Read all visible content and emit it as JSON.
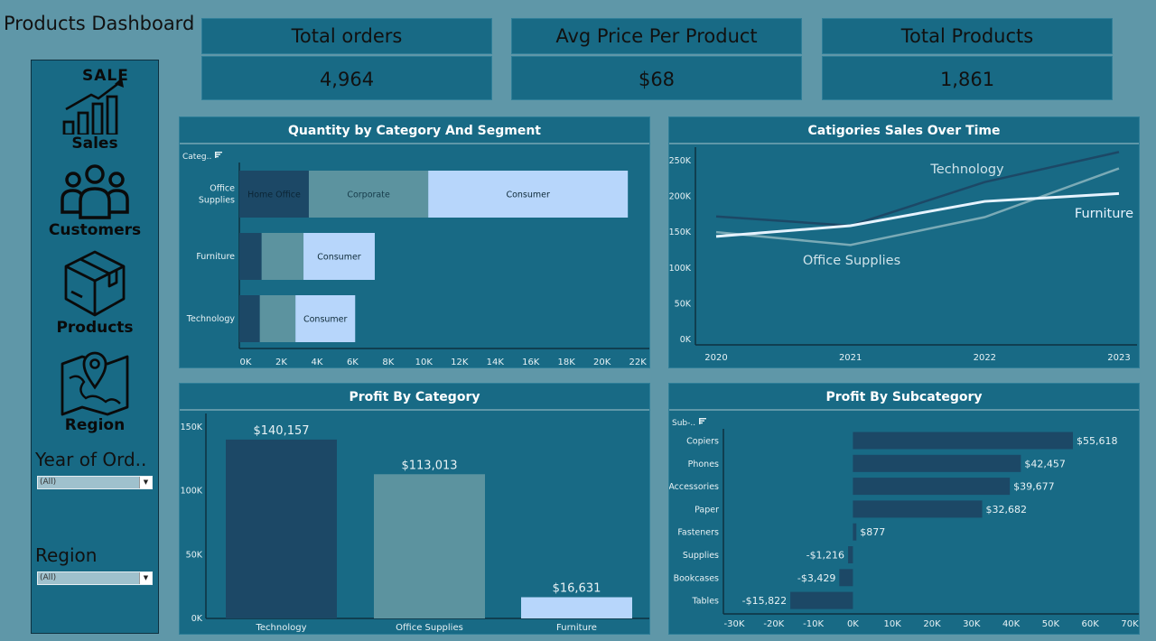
{
  "dashboard": {
    "title": "Products Dashboard"
  },
  "sidebar": {
    "items": [
      {
        "label": "Sales",
        "icon": "sales-chart-icon",
        "icon_text": "SALE"
      },
      {
        "label": "Customers",
        "icon": "customers-icon"
      },
      {
        "label": "Products",
        "icon": "box-icon"
      },
      {
        "label": "Region",
        "icon": "map-pin-icon"
      }
    ],
    "filters": [
      {
        "label": "Year of Ord..",
        "value": "(All)"
      },
      {
        "label": "Region",
        "value": "(All)"
      }
    ]
  },
  "kpis": [
    {
      "label": "Total orders",
      "value": "4,964"
    },
    {
      "label": "Avg Price  Per Product",
      "value": "$68"
    },
    {
      "label": "Total Products",
      "value": "1,861"
    }
  ],
  "colors": {
    "background": "#5f97a8",
    "panel": "#186a85",
    "dark": "#1c4866",
    "mid": "#5c939f",
    "light": "#b7d6fb"
  },
  "chart_data": [
    {
      "type": "bar",
      "orientation": "horizontal-stacked",
      "title": "Quantity by Category And Segment",
      "row_header": "Categ..",
      "categories": [
        "Office Supplies",
        "Furniture",
        "Technology"
      ],
      "category_labels": [
        [
          "Office",
          "Supplies"
        ],
        [
          "Furniture"
        ],
        [
          "Technology"
        ]
      ],
      "series": [
        {
          "name": "Home Office",
          "values": [
            3900,
            1250,
            1150
          ],
          "labels": [
            "Home Office",
            "",
            ""
          ],
          "color": "#1c4866",
          "text_color": "#0b2535"
        },
        {
          "name": "Corporate",
          "values": [
            6700,
            2350,
            2000
          ],
          "labels": [
            "Corporate",
            "",
            ""
          ],
          "color": "#5c939f",
          "text_color": "#163b4a"
        },
        {
          "name": "Consumer",
          "values": [
            11200,
            4000,
            3350
          ],
          "labels": [
            "Consumer",
            "Consumer",
            "Consumer"
          ],
          "color": "#b7d6fb",
          "text_color": "#0e2a38"
        }
      ],
      "xlim": [
        0,
        22500
      ],
      "xticks": [
        0,
        2000,
        4000,
        6000,
        8000,
        10000,
        12000,
        14000,
        16000,
        18000,
        20000,
        22000
      ],
      "xtick_labels": [
        "0K",
        "2K",
        "4K",
        "6K",
        "8K",
        "10K",
        "12K",
        "14K",
        "16K",
        "18K",
        "20K",
        "22K"
      ]
    },
    {
      "type": "line",
      "title": "Catigories Sales Over Time",
      "x": [
        "2020",
        "2021",
        "2022",
        "2023"
      ],
      "series": [
        {
          "name": "Technology",
          "values": [
            172000,
            159000,
            220000,
            262000
          ],
          "color": "#1c4866",
          "label_color": "#cfe3ea"
        },
        {
          "name": "Furniture",
          "values": [
            144000,
            159000,
            193000,
            204000
          ],
          "color": "#e6f3ff",
          "label_color": "#e6f3ff"
        },
        {
          "name": "Office Supplies",
          "values": [
            150000,
            132000,
            171000,
            239000
          ],
          "color": "#7aaab6",
          "label_color": "#cfe3ea"
        }
      ],
      "ylim": [
        0,
        265000
      ],
      "yticks": [
        0,
        50000,
        100000,
        150000,
        200000,
        250000
      ],
      "ytick_labels": [
        "0K",
        "50K",
        "100K",
        "150K",
        "200K",
        "250K"
      ]
    },
    {
      "type": "bar",
      "title": "Profit By Category",
      "categories": [
        "Technology",
        "Office Supplies",
        "Furniture"
      ],
      "values": [
        140157,
        113013,
        16631
      ],
      "value_labels": [
        "$140,157",
        "$113,013",
        "$16,631"
      ],
      "colors": [
        "#1c4866",
        "#5c939f",
        "#b7d6fb"
      ],
      "ylim": [
        0,
        150000
      ],
      "yticks": [
        0,
        50000,
        100000,
        150000
      ],
      "ytick_labels": [
        "0K",
        "50K",
        "100K",
        "150K"
      ]
    },
    {
      "type": "bar",
      "orientation": "horizontal",
      "title": "Profit By Subcategory",
      "row_header": "Sub-..",
      "categories": [
        "Copiers",
        "Phones",
        "Accessories",
        "Paper",
        "Fasteners",
        "Supplies",
        "Bookcases",
        "Tables"
      ],
      "values": [
        55618,
        42457,
        39677,
        32682,
        877,
        -1216,
        -3429,
        -15822
      ],
      "value_labels": [
        "$55,618",
        "$42,457",
        "$39,677",
        "$32,682",
        "$877",
        "-$1,216",
        "-$3,429",
        "-$15,822"
      ],
      "color": "#1c4866",
      "xlim": [
        -30000,
        70000
      ],
      "xticks": [
        -30000,
        -20000,
        -10000,
        0,
        10000,
        20000,
        30000,
        40000,
        50000,
        60000,
        70000
      ],
      "xtick_labels": [
        "-30K",
        "-20K",
        "-10K",
        "0K",
        "10K",
        "20K",
        "30K",
        "40K",
        "50K",
        "60K",
        "70K"
      ]
    }
  ]
}
